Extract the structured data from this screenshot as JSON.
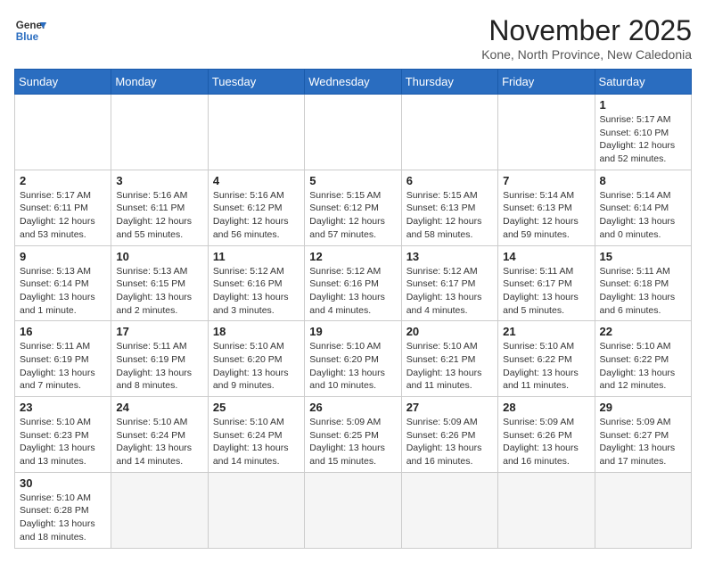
{
  "logo": {
    "line1": "General",
    "line2": "Blue"
  },
  "title": "November 2025",
  "subtitle": "Kone, North Province, New Caledonia",
  "weekdays": [
    "Sunday",
    "Monday",
    "Tuesday",
    "Wednesday",
    "Thursday",
    "Friday",
    "Saturday"
  ],
  "weeks": [
    [
      {
        "day": "",
        "info": ""
      },
      {
        "day": "",
        "info": ""
      },
      {
        "day": "",
        "info": ""
      },
      {
        "day": "",
        "info": ""
      },
      {
        "day": "",
        "info": ""
      },
      {
        "day": "",
        "info": ""
      },
      {
        "day": "1",
        "info": "Sunrise: 5:17 AM\nSunset: 6:10 PM\nDaylight: 12 hours\nand 52 minutes."
      }
    ],
    [
      {
        "day": "2",
        "info": "Sunrise: 5:17 AM\nSunset: 6:11 PM\nDaylight: 12 hours\nand 53 minutes."
      },
      {
        "day": "3",
        "info": "Sunrise: 5:16 AM\nSunset: 6:11 PM\nDaylight: 12 hours\nand 55 minutes."
      },
      {
        "day": "4",
        "info": "Sunrise: 5:16 AM\nSunset: 6:12 PM\nDaylight: 12 hours\nand 56 minutes."
      },
      {
        "day": "5",
        "info": "Sunrise: 5:15 AM\nSunset: 6:12 PM\nDaylight: 12 hours\nand 57 minutes."
      },
      {
        "day": "6",
        "info": "Sunrise: 5:15 AM\nSunset: 6:13 PM\nDaylight: 12 hours\nand 58 minutes."
      },
      {
        "day": "7",
        "info": "Sunrise: 5:14 AM\nSunset: 6:13 PM\nDaylight: 12 hours\nand 59 minutes."
      },
      {
        "day": "8",
        "info": "Sunrise: 5:14 AM\nSunset: 6:14 PM\nDaylight: 13 hours\nand 0 minutes."
      }
    ],
    [
      {
        "day": "9",
        "info": "Sunrise: 5:13 AM\nSunset: 6:14 PM\nDaylight: 13 hours\nand 1 minute."
      },
      {
        "day": "10",
        "info": "Sunrise: 5:13 AM\nSunset: 6:15 PM\nDaylight: 13 hours\nand 2 minutes."
      },
      {
        "day": "11",
        "info": "Sunrise: 5:12 AM\nSunset: 6:16 PM\nDaylight: 13 hours\nand 3 minutes."
      },
      {
        "day": "12",
        "info": "Sunrise: 5:12 AM\nSunset: 6:16 PM\nDaylight: 13 hours\nand 4 minutes."
      },
      {
        "day": "13",
        "info": "Sunrise: 5:12 AM\nSunset: 6:17 PM\nDaylight: 13 hours\nand 4 minutes."
      },
      {
        "day": "14",
        "info": "Sunrise: 5:11 AM\nSunset: 6:17 PM\nDaylight: 13 hours\nand 5 minutes."
      },
      {
        "day": "15",
        "info": "Sunrise: 5:11 AM\nSunset: 6:18 PM\nDaylight: 13 hours\nand 6 minutes."
      }
    ],
    [
      {
        "day": "16",
        "info": "Sunrise: 5:11 AM\nSunset: 6:19 PM\nDaylight: 13 hours\nand 7 minutes."
      },
      {
        "day": "17",
        "info": "Sunrise: 5:11 AM\nSunset: 6:19 PM\nDaylight: 13 hours\nand 8 minutes."
      },
      {
        "day": "18",
        "info": "Sunrise: 5:10 AM\nSunset: 6:20 PM\nDaylight: 13 hours\nand 9 minutes."
      },
      {
        "day": "19",
        "info": "Sunrise: 5:10 AM\nSunset: 6:20 PM\nDaylight: 13 hours\nand 10 minutes."
      },
      {
        "day": "20",
        "info": "Sunrise: 5:10 AM\nSunset: 6:21 PM\nDaylight: 13 hours\nand 11 minutes."
      },
      {
        "day": "21",
        "info": "Sunrise: 5:10 AM\nSunset: 6:22 PM\nDaylight: 13 hours\nand 11 minutes."
      },
      {
        "day": "22",
        "info": "Sunrise: 5:10 AM\nSunset: 6:22 PM\nDaylight: 13 hours\nand 12 minutes."
      }
    ],
    [
      {
        "day": "23",
        "info": "Sunrise: 5:10 AM\nSunset: 6:23 PM\nDaylight: 13 hours\nand 13 minutes."
      },
      {
        "day": "24",
        "info": "Sunrise: 5:10 AM\nSunset: 6:24 PM\nDaylight: 13 hours\nand 14 minutes."
      },
      {
        "day": "25",
        "info": "Sunrise: 5:10 AM\nSunset: 6:24 PM\nDaylight: 13 hours\nand 14 minutes."
      },
      {
        "day": "26",
        "info": "Sunrise: 5:09 AM\nSunset: 6:25 PM\nDaylight: 13 hours\nand 15 minutes."
      },
      {
        "day": "27",
        "info": "Sunrise: 5:09 AM\nSunset: 6:26 PM\nDaylight: 13 hours\nand 16 minutes."
      },
      {
        "day": "28",
        "info": "Sunrise: 5:09 AM\nSunset: 6:26 PM\nDaylight: 13 hours\nand 16 minutes."
      },
      {
        "day": "29",
        "info": "Sunrise: 5:09 AM\nSunset: 6:27 PM\nDaylight: 13 hours\nand 17 minutes."
      }
    ],
    [
      {
        "day": "30",
        "info": "Sunrise: 5:10 AM\nSunset: 6:28 PM\nDaylight: 13 hours\nand 18 minutes."
      },
      {
        "day": "",
        "info": ""
      },
      {
        "day": "",
        "info": ""
      },
      {
        "day": "",
        "info": ""
      },
      {
        "day": "",
        "info": ""
      },
      {
        "day": "",
        "info": ""
      },
      {
        "day": "",
        "info": ""
      }
    ]
  ]
}
